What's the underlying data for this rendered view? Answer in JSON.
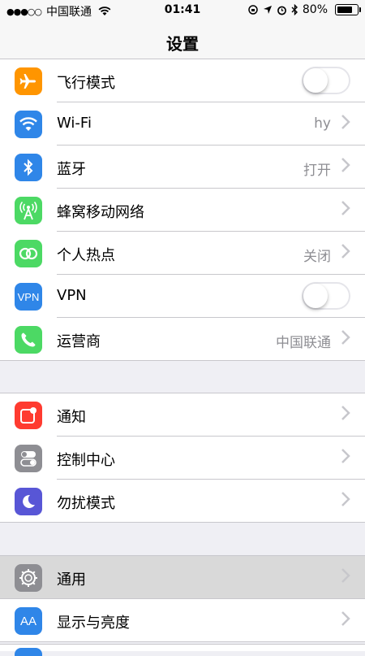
{
  "status_bar": {
    "signal_dots": "●●●○○",
    "carrier": "中国联通",
    "time": "01:41",
    "battery": "80%",
    "battery_level_pct": 80
  },
  "nav": {
    "title": "设置"
  },
  "group1": [
    {
      "label": "飞行模式",
      "icon": "airplane-icon",
      "icon_color": "#ff9500",
      "toggle": true,
      "toggle_on": false
    },
    {
      "label": "Wi-Fi",
      "value": "hy",
      "icon": "wifi-icon",
      "icon_color": "#2f86e8"
    },
    {
      "label": "蓝牙",
      "value": "打开",
      "icon": "bluetooth-icon",
      "icon_color": "#2f86e8"
    },
    {
      "label": "蜂窝移动网络",
      "value": "",
      "icon": "cellular-icon",
      "icon_color": "#4cd964"
    },
    {
      "label": "个人热点",
      "value": "关闭",
      "icon": "hotspot-icon",
      "icon_color": "#4cd964"
    },
    {
      "label": "VPN",
      "icon_text": "VPN",
      "icon": "vpn-icon",
      "icon_color": "#2f86e8",
      "toggle": true,
      "toggle_on": false
    },
    {
      "label": "运营商",
      "value": "中国联通",
      "icon": "phone-icon",
      "icon_color": "#4cd964"
    }
  ],
  "group2": [
    {
      "label": "通知",
      "icon": "notifications-icon",
      "icon_color": "#ff3b30"
    },
    {
      "label": "控制中心",
      "icon": "control-center-icon",
      "icon_color": "#8e8e93"
    },
    {
      "label": "勿扰模式",
      "icon": "moon-icon",
      "icon_color": "#5856d6"
    }
  ],
  "group3": [
    {
      "label": "通用",
      "icon": "gear-icon",
      "icon_color": "#8e8e93",
      "highlighted": true
    },
    {
      "label": "显示与亮度",
      "icon_text": "AA",
      "icon": "display-icon",
      "icon_color": "#2f86e8"
    }
  ]
}
